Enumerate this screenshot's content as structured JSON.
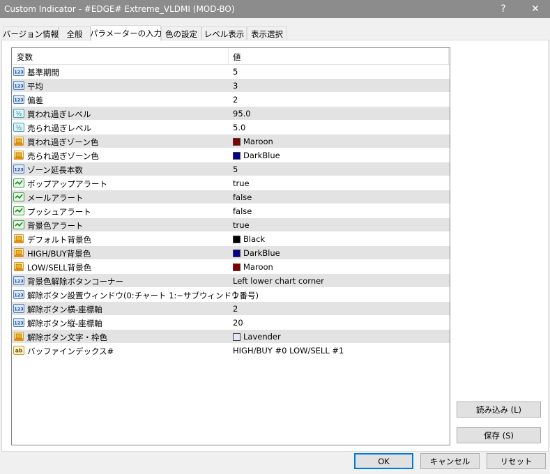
{
  "window": {
    "title": "Custom Indicator - #EDGE# Extreme_VLDMI (MOD-BO)",
    "help_glyph": "?",
    "close_glyph": "✕"
  },
  "tabs": [
    {
      "label": "バージョン情報"
    },
    {
      "label": "全般"
    },
    {
      "label": "パラメーターの入力"
    },
    {
      "label": "色の設定"
    },
    {
      "label": "レベル表示"
    },
    {
      "label": "表示選択"
    }
  ],
  "grid": {
    "col_name": "変数",
    "col_value": "値",
    "rows": [
      {
        "icon": "int-icon",
        "name": "基準期間",
        "value": "5"
      },
      {
        "icon": "int-icon",
        "name": "平均",
        "value": "3"
      },
      {
        "icon": "int-icon",
        "name": "偏差",
        "value": "2"
      },
      {
        "icon": "double-icon",
        "name": "買われ過ぎレベル",
        "value": "95.0"
      },
      {
        "icon": "double-icon",
        "name": "売られ過ぎレベル",
        "value": "5.0"
      },
      {
        "icon": "color-icon",
        "name": "買われ過ぎゾーン色",
        "value": "Maroon",
        "color": "#800000"
      },
      {
        "icon": "color-icon",
        "name": "売られ過ぎゾーン色",
        "value": "DarkBlue",
        "color": "#00008b"
      },
      {
        "icon": "int-icon",
        "name": "ゾーン延長本数",
        "value": "5"
      },
      {
        "icon": "bool-icon",
        "name": "ポップアップアラート",
        "value": "true"
      },
      {
        "icon": "bool-icon",
        "name": "メールアラート",
        "value": "false"
      },
      {
        "icon": "bool-icon",
        "name": "プッシュアラート",
        "value": "false"
      },
      {
        "icon": "bool-icon",
        "name": "背景色アラート",
        "value": "true"
      },
      {
        "icon": "color-icon",
        "name": "デフォルト背景色",
        "value": "Black",
        "color": "#000000"
      },
      {
        "icon": "color-icon",
        "name": "HIGH/BUY背景色",
        "value": "DarkBlue",
        "color": "#00008b"
      },
      {
        "icon": "color-icon",
        "name": "LOW/SELL背景色",
        "value": "Maroon",
        "color": "#800000"
      },
      {
        "icon": "int-icon",
        "name": "背景色解除ボタンコーナー",
        "value": "Left lower chart corner"
      },
      {
        "icon": "int-icon",
        "name": "解除ボタン設置ウィンドウ(0:チャート 1:~サブウィンドウ番号)",
        "value": "1"
      },
      {
        "icon": "int-icon",
        "name": "解除ボタン横-座標軸",
        "value": "2"
      },
      {
        "icon": "int-icon",
        "name": "解除ボタン縦-座標軸",
        "value": "20"
      },
      {
        "icon": "color-icon",
        "name": "解除ボタン文字・枠色",
        "value": "Lavender",
        "color": "#e6e6fa"
      },
      {
        "icon": "string-icon",
        "name": "バッファインデックス#",
        "value": "HIGH/BUY #0   LOW/SELL #1"
      }
    ]
  },
  "buttons": {
    "load": "読み込み (L)",
    "save": "保存 (S)",
    "ok": "OK",
    "cancel": "キャンセル",
    "reset": "リセット"
  },
  "icon_labels": {
    "int": "123",
    "double": "½",
    "string": "ab"
  },
  "colors": {
    "titlebar": "#8c8c8c",
    "accent": "#0078d7",
    "row_alt": "#e3e3e3"
  }
}
